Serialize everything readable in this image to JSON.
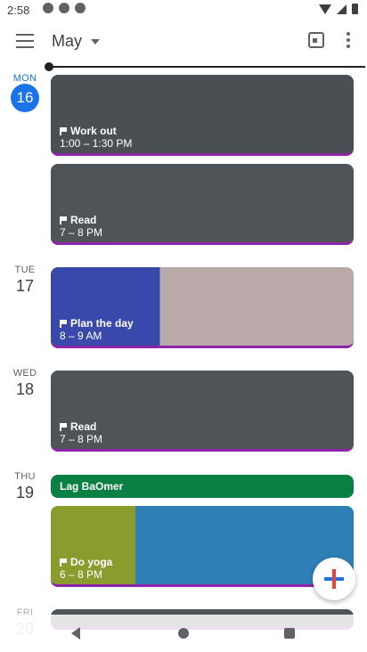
{
  "status_bar": {
    "time": "2:58"
  },
  "header": {
    "month_label": "May"
  },
  "days": [
    {
      "dow": "MON",
      "date": "16",
      "today": true
    },
    {
      "dow": "TUE",
      "date": "17"
    },
    {
      "dow": "WED",
      "date": "18"
    },
    {
      "dow": "THU",
      "date": "19"
    },
    {
      "dow": "FRI",
      "date": "20"
    }
  ],
  "events": [
    {
      "title": "Work out",
      "time": "1:00 – 1:30 PM"
    },
    {
      "title": "Read",
      "time": "7 – 8 PM"
    },
    {
      "title": "Plan the day",
      "time": "8 – 9 AM"
    },
    {
      "title": "Read",
      "time": "7 – 8 PM"
    },
    {
      "title": "Lag BaOmer"
    },
    {
      "title": "Do yoga",
      "time": "6 – 8 PM"
    }
  ],
  "colors": {
    "accent": "#1a73e8",
    "event_border": "#8e24aa",
    "holiday": "#0b8043"
  },
  "icons": [
    "menu-icon",
    "chevron-down-icon",
    "today-calendar-icon",
    "more-vert-icon",
    "add-icon",
    "flag-icon"
  ]
}
